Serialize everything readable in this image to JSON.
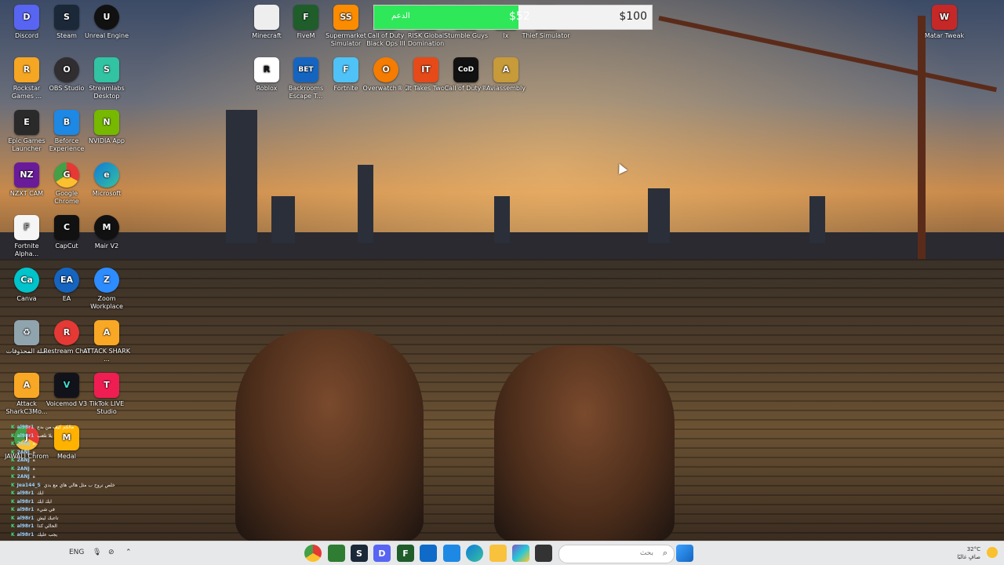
{
  "desktop": {
    "icons": [
      {
        "label": "Discord",
        "glyph": "D",
        "color": "#5865f2"
      },
      {
        "label": "Steam",
        "glyph": "S",
        "color": "#1b2838"
      },
      {
        "label": "Unreal Engine",
        "glyph": "U",
        "color": "#111111"
      },
      {
        "label": "Rockstar Games ...",
        "glyph": "R",
        "color": "#f5a623"
      },
      {
        "label": "OBS Studio",
        "glyph": "O",
        "color": "#302e31"
      },
      {
        "label": "Streamlabs Desktop",
        "glyph": "S",
        "color": "#31c3a2"
      },
      {
        "label": "Epic Games Launcher",
        "glyph": "E",
        "color": "#2a2a2a"
      },
      {
        "label": "Beforce Experience",
        "glyph": "B",
        "color": "#1e88e5"
      },
      {
        "label": "NVIDIA App",
        "glyph": "N",
        "color": "#76b900"
      },
      {
        "label": "NZXT CAM",
        "glyph": "NZ",
        "color": "#6a1b9a"
      },
      {
        "label": "Google Chrome",
        "glyph": "G",
        "color": "#e53935"
      },
      {
        "label": "Microsoft",
        "glyph": "e",
        "color": "#0f7bd8"
      },
      {
        "label": "Fortnite Alpha...",
        "glyph": "F",
        "color": "#f5f5f5"
      },
      {
        "label": "CapCut",
        "glyph": "C",
        "color": "#111111"
      },
      {
        "label": "Mair V2",
        "glyph": "M",
        "color": "#111111"
      },
      {
        "label": "Canva",
        "glyph": "Ca",
        "color": "#00c4cc"
      },
      {
        "label": "EA",
        "glyph": "EA",
        "color": "#1565c0"
      },
      {
        "label": "Zoom Workplace",
        "glyph": "Z",
        "color": "#2d8cff"
      },
      {
        "label": "سلة المحذوفات",
        "glyph": "♻",
        "color": "#90a4ae"
      },
      {
        "label": "Restream Chat",
        "glyph": "R",
        "color": "#e53935"
      },
      {
        "label": "ATTACK SHARK ...",
        "glyph": "A",
        "color": "#f9a825"
      },
      {
        "label": "Attack SharkC3Mo...",
        "glyph": "A",
        "color": "#f9a825"
      },
      {
        "label": "Voicemod V3",
        "glyph": "V",
        "color": "#12131a"
      },
      {
        "label": "TikTok LIVE Studio",
        "glyph": "T",
        "color": "#ee1d52"
      },
      {
        "label": "JAWALI Chrom",
        "glyph": "J",
        "color": "#43a047"
      },
      {
        "label": "Medal",
        "glyph": "M",
        "color": "#ffb300"
      },
      {
        "label": "Minecraft",
        "glyph": "",
        "color": "#eeeeee"
      },
      {
        "label": "FiveM",
        "glyph": "F",
        "color": "#1f5d2b"
      },
      {
        "label": "Supermarket Simulator",
        "glyph": "SS",
        "color": "#fb8c00"
      },
      {
        "label": "Call of Duty Black Ops III",
        "glyph": "C",
        "color": "#c62828"
      },
      {
        "label": "RISK Global Domination",
        "glyph": "R",
        "color": "#7b1fa2"
      },
      {
        "label": "Stumble Guys",
        "glyph": "S",
        "color": "#ffca28"
      },
      {
        "label": "lx",
        "glyph": "X",
        "color": "#fdd835"
      },
      {
        "label": "Thief Simulator",
        "glyph": "T",
        "color": "#546e7a"
      },
      {
        "label": "Roblox",
        "glyph": "R",
        "color": "#ffffff"
      },
      {
        "label": "Backrooms Escape T...",
        "glyph": "BET",
        "color": "#1565c0"
      },
      {
        "label": "Fortnite",
        "glyph": "F",
        "color": "#4fc3f7"
      },
      {
        "label": "Overwatch® 2",
        "glyph": "O",
        "color": "#f57c00"
      },
      {
        "label": "It Takes Two",
        "glyph": "IT",
        "color": "#e64a19"
      },
      {
        "label": "Call of Duty®",
        "glyph": "CoD",
        "color": "#111111"
      },
      {
        "label": "Aviassembly",
        "glyph": "A",
        "color": "#c79a3a"
      },
      {
        "label": "Matar Tweak",
        "glyph": "W",
        "color": "#c62828"
      }
    ]
  },
  "donation": {
    "label": "الدعم",
    "current": "$52",
    "goal": "$100",
    "progress_fraction": 0.52,
    "bar_color": "#2ee85a"
  },
  "chat": {
    "rows": [
      {
        "user": "al98r1",
        "text": "مالكم كيف من بدع"
      },
      {
        "user": "al98r1",
        "text": "يلا نلعب"
      },
      {
        "user": "2ANJ",
        "text": "ه"
      },
      {
        "user": "2ANJ",
        "text": "ه"
      },
      {
        "user": "2ANJ",
        "text": "ه"
      },
      {
        "user": "2ANJ",
        "text": "ه"
      },
      {
        "user": "2ANJ",
        "text": "ه"
      },
      {
        "user": "Jea144_S",
        "text": "خلص نروح ب مثل هالي هاي مع بدي"
      },
      {
        "user": "al98r1",
        "text": "ابك"
      },
      {
        "user": "al98r1",
        "text": "ابك ابك"
      },
      {
        "user": "al98r1",
        "text": "في شيء"
      },
      {
        "user": "al98r1",
        "text": "تاعبك ليش"
      },
      {
        "user": "al98r1",
        "text": "الحالي كذا"
      },
      {
        "user": "al98r1",
        "text": "يجب عليك"
      }
    ]
  },
  "taskbar": {
    "language": "ENG",
    "search_placeholder": "بحث",
    "weather_temp": "32°C",
    "weather_desc": "صافٍ غالبًا",
    "pinned": [
      "chrome-icon",
      "app-icon",
      "steam-icon",
      "discord-icon",
      "fivem-icon",
      "store-icon",
      "mail-icon",
      "edge-icon",
      "folder-icon",
      "copilot-icon",
      "terminal-icon"
    ]
  }
}
